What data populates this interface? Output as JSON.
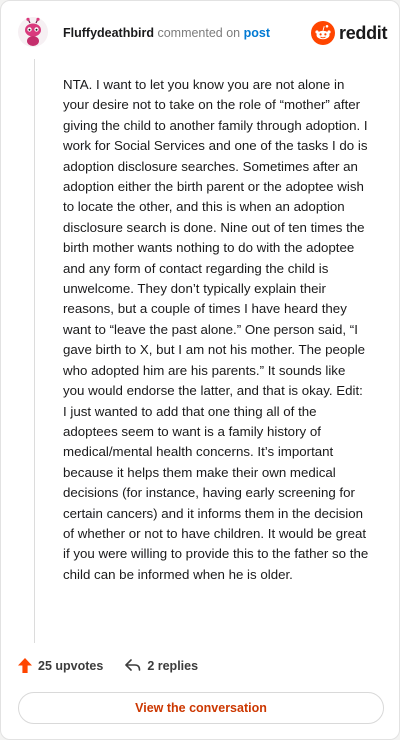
{
  "comment": {
    "username": "Fluffydeathbird",
    "action_text": "commented on",
    "post_link": "post",
    "brand": "reddit",
    "body": "NTA. I want to let you know you are not alone in your desire not to take on the role of “mother” after giving the child to another family through adoption. I work for Social Services and one of the tasks I do is adoption disclosure searches. Sometimes after an adoption either the birth parent or the adoptee wish to locate the other, and this is when an adoption disclosure search is done. Nine out of ten times the birth mother wants nothing to do with the adoptee and any form of contact regarding the child is unwelcome. They don’t typically explain their reasons, but a couple of times I have heard they want to “leave the past alone.” One person said, “I gave birth to X, but I am not his mother. The people who adopted him are his parents.” It sounds like you would endorse the latter, and that is okay. Edit: I just wanted to add that one thing all of the adoptees seem to want is a family history of medical/mental health concerns. It’s important because it helps them make their own medical decisions (for instance, having early screening for certain cancers) and it informs them in the decision of whether or not to have children. It would be great if you were willing to provide this to the father so the child can be informed when he is older.",
    "upvotes": "25 upvotes",
    "replies": "2 replies",
    "cta": "View the conversation"
  },
  "colors": {
    "brand_orange": "#ff4500",
    "upvote_orange": "#ff4500",
    "link_blue": "#0079d3",
    "cta_text": "#cc3700",
    "avatar_pink": "#d93a7d"
  },
  "icons": {
    "avatar": "snoo-avatar-icon",
    "logo": "reddit-logo-icon",
    "upvote": "upvote-arrow-icon",
    "reply": "reply-arrow-icon"
  }
}
